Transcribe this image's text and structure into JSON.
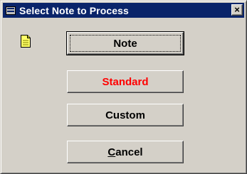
{
  "window": {
    "title": "Select Note to Process",
    "close_label": "×"
  },
  "icons": {
    "app": "app-window-icon",
    "note": "note-page-icon"
  },
  "buttons": {
    "note": "Note",
    "standard": "Standard",
    "custom": "Custom",
    "cancel_mnemonic": "C",
    "cancel_rest": "ancel"
  },
  "colors": {
    "titlebar": "#0a246a",
    "dialog_bg": "#d4d0c8",
    "standard_text": "#ff0000",
    "note_icon": "#ffff66"
  }
}
